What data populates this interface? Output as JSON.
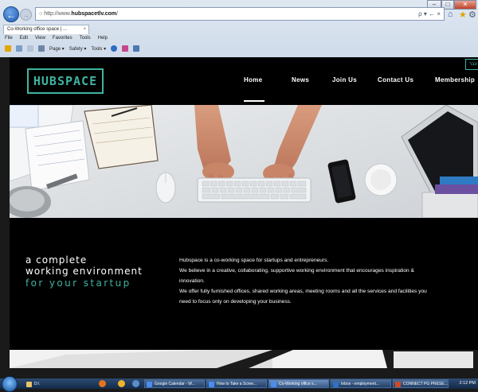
{
  "browser": {
    "url_prefix": "http://www.",
    "url_host": "hubspacetlv.com",
    "url_suffix": "/",
    "url_controls": "ρ ▾ ← ×",
    "tab_title": "Co-Working office space | ...",
    "menu": [
      "File",
      "Edit",
      "View",
      "Favorites",
      "Tools",
      "Help"
    ],
    "command_bar": {
      "page": "Page ▾",
      "safety": "Safety ▾",
      "tools": "Tools ▾"
    }
  },
  "site": {
    "logo": "HUBSPACE",
    "nav": [
      "Home",
      "News",
      "Join Us",
      "Contact Us",
      "Membership"
    ],
    "active_nav": "Home",
    "lang_toggle": "עבר",
    "tagline": {
      "line1": "a complete",
      "line2": "working environment",
      "line3": "for your startup"
    },
    "body_lines": [
      "Hubspace is a co-working space for startups and entrepreneurs.",
      "We believe in a creative, collaborating, supportive working environment that encourages inspiration &",
      "innovation.",
      "We offer fully furnished offices, shared working areas, meeting rooms and all the services and facilities you",
      "need to focus only on developing your business."
    ],
    "accent_color": "#3fb3a2"
  },
  "taskbar": {
    "start_label": "",
    "folder": "D:\\",
    "items": [
      "Google Calendar - W...",
      "How to Take a Scree...",
      "Co-Working office s...",
      "Inbox - employment...",
      "CONNECT PG PRESE..."
    ],
    "clock": "2:12 PM"
  }
}
